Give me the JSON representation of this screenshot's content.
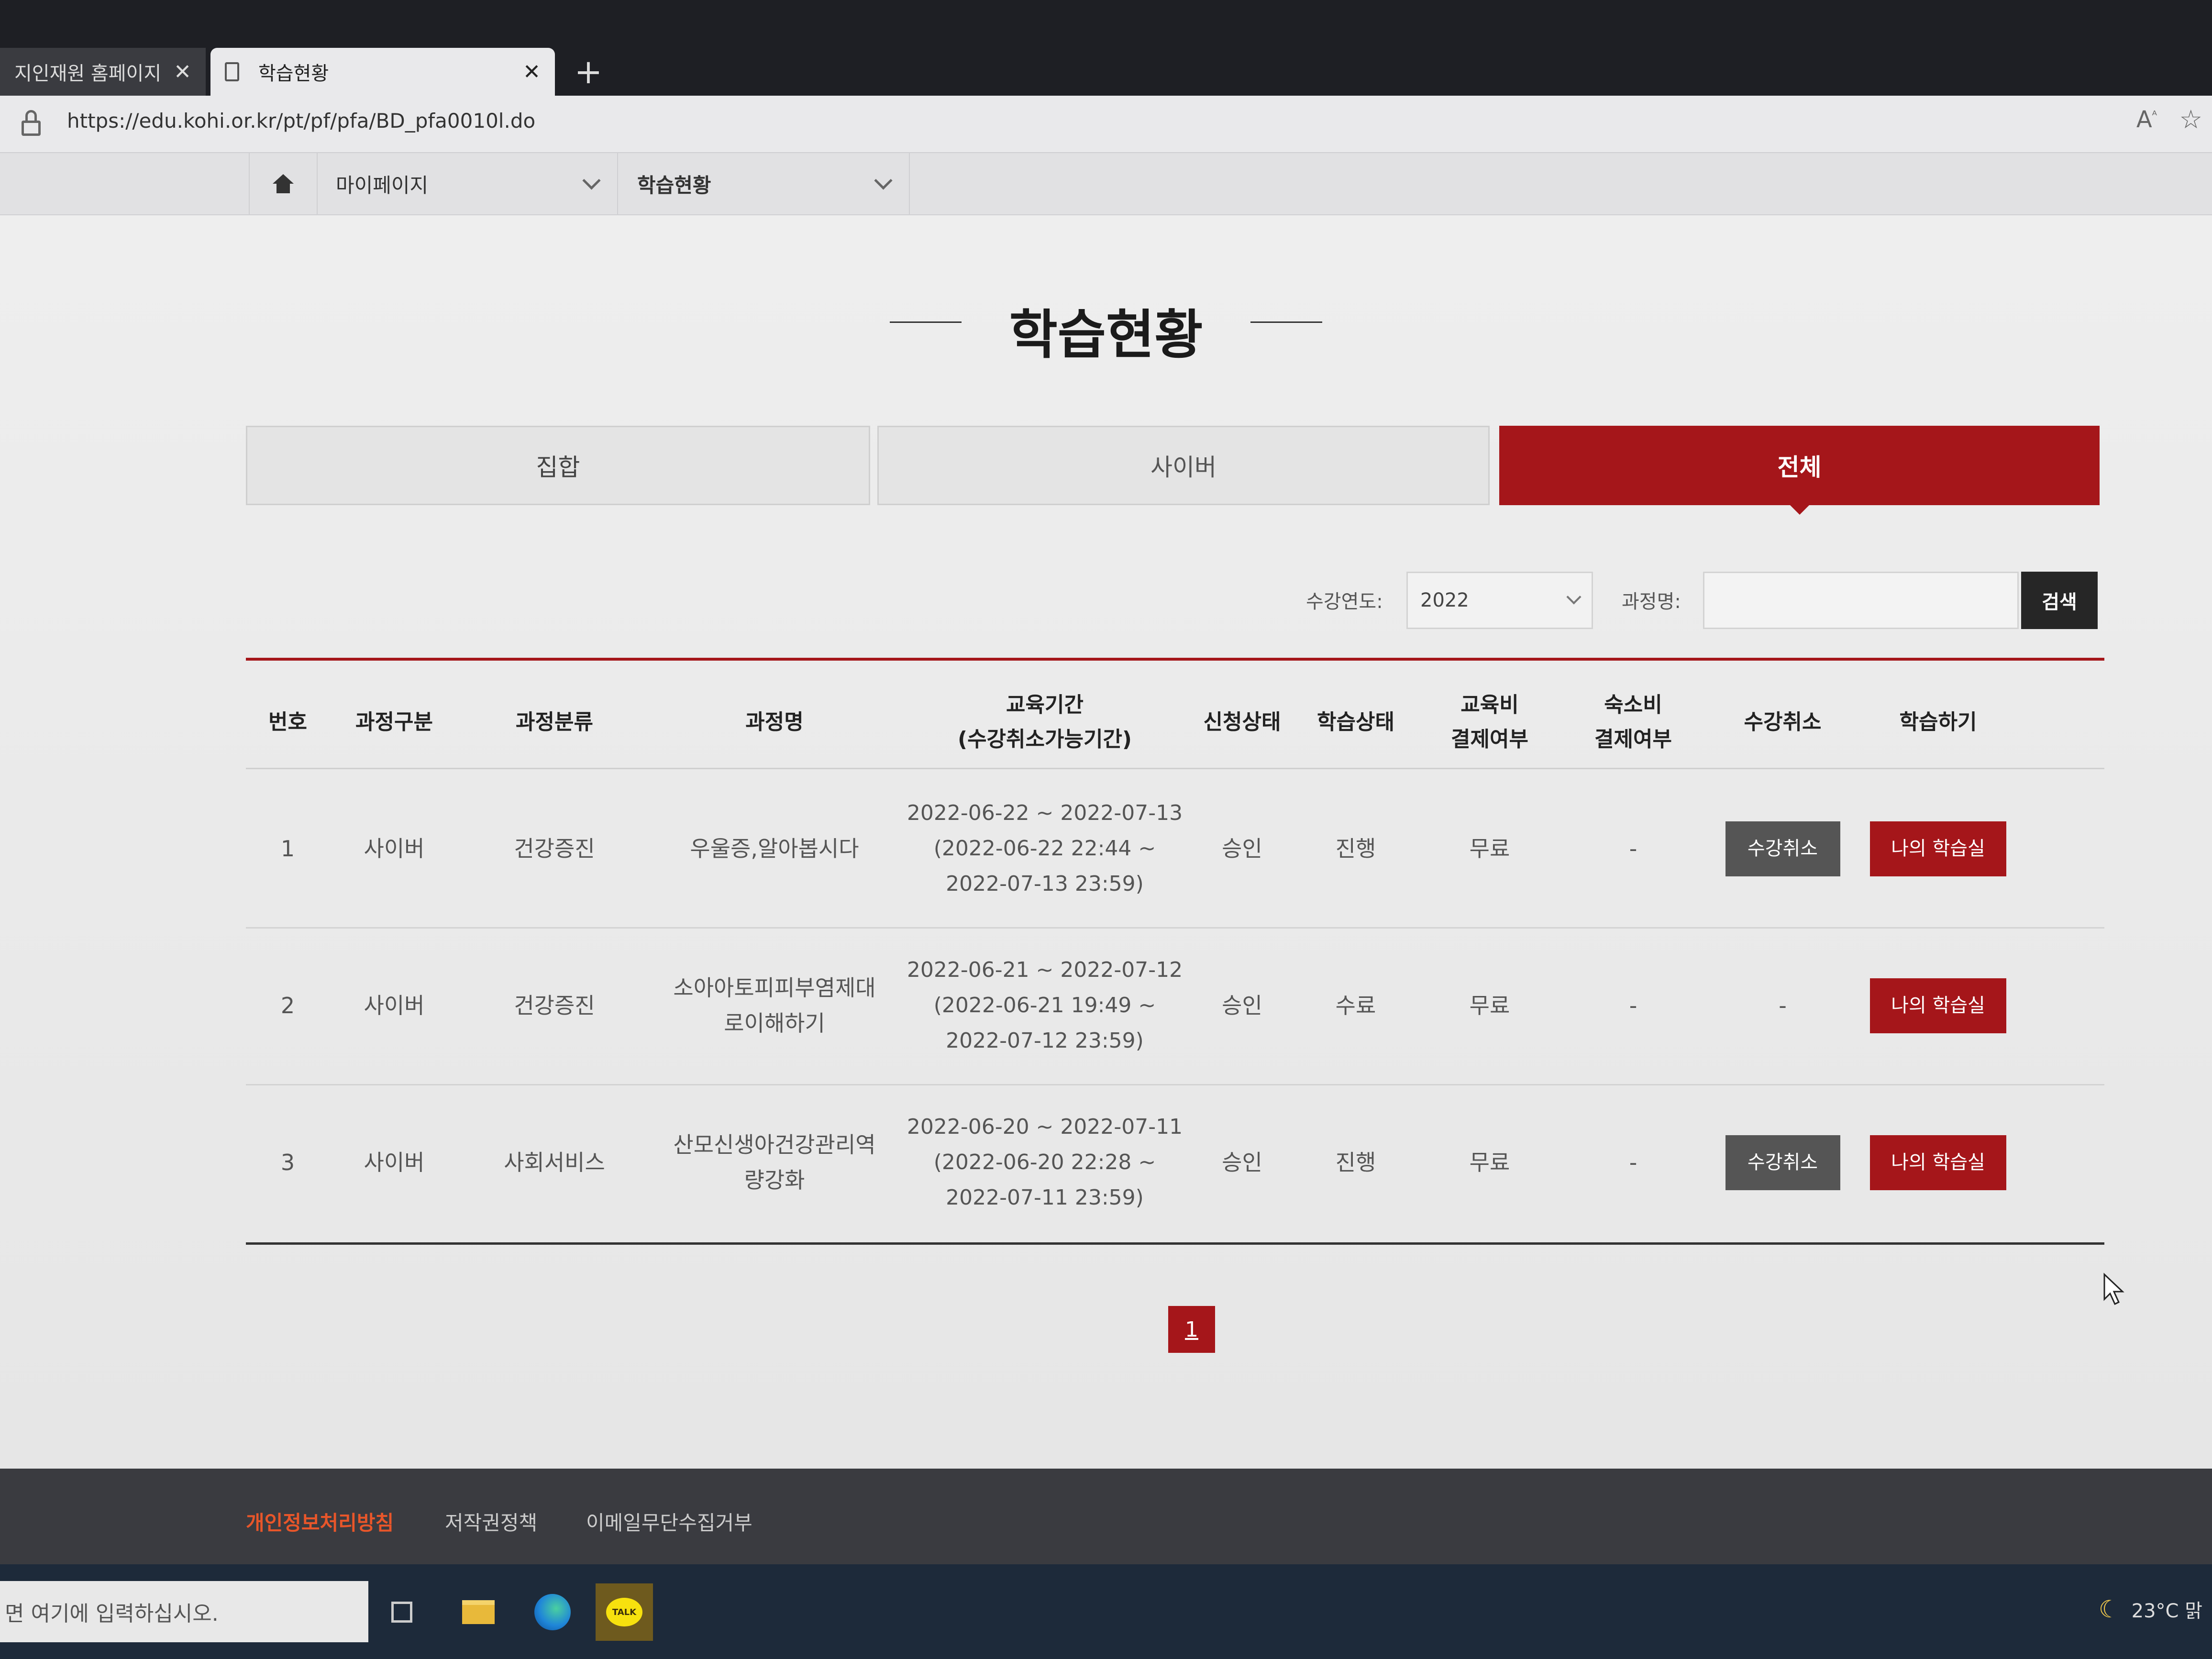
{
  "browser": {
    "tabs": [
      {
        "title": "지인재원 홈페이지 :",
        "active": false
      },
      {
        "title": "학습현황",
        "active": true
      }
    ],
    "url": "https://edu.kohi.or.kr/pt/pf/pfa/BD_pfa0010l.do",
    "new_tab": "+",
    "close": "✕"
  },
  "nav": {
    "home_icon": "home-icon",
    "items": [
      {
        "label": "마이페이지"
      },
      {
        "label": "학습현황"
      }
    ]
  },
  "page": {
    "title": "학습현황",
    "tabs": [
      {
        "label": "집합",
        "active": false
      },
      {
        "label": "사이버",
        "active": false
      },
      {
        "label": "전체",
        "active": true
      }
    ]
  },
  "search": {
    "year_label": "수강연도:",
    "year_value": "2022",
    "course_label": "과정명:",
    "course_value": "",
    "button": "검색"
  },
  "table": {
    "headers": {
      "no": "번호",
      "type": "과정구분",
      "category": "과정분류",
      "name": "과정명",
      "period_1": "교육기간",
      "period_2": "(수강취소가능기간)",
      "apply": "신청상태",
      "learn": "학습상태",
      "fee_1": "교육비",
      "fee_2": "결제여부",
      "lodging_1": "숙소비",
      "lodging_2": "결제여부",
      "cancel": "수강취소",
      "study": "학습하기"
    },
    "rows": [
      {
        "no": "1",
        "type": "사이버",
        "category": "건강증진",
        "name_1": "우울증,알아봅시다",
        "name_2": "",
        "period": "2022-06-22 ~ 2022-07-13",
        "cancel_1": "(2022-06-22 22:44 ~",
        "cancel_2": "2022-07-13 23:59)",
        "apply": "승인",
        "learn": "진행",
        "fee": "무료",
        "lodging": "-",
        "cancel_btn": "수강취소",
        "study_btn": "나의 학습실"
      },
      {
        "no": "2",
        "type": "사이버",
        "category": "건강증진",
        "name_1": "소아아토피피부염제대",
        "name_2": "로이해하기",
        "period": "2022-06-21 ~ 2022-07-12",
        "cancel_1": "(2022-06-21 19:49 ~",
        "cancel_2": "2022-07-12 23:59)",
        "apply": "승인",
        "learn": "수료",
        "fee": "무료",
        "lodging": "-",
        "cancel_text": "-",
        "study_btn": "나의 학습실"
      },
      {
        "no": "3",
        "type": "사이버",
        "category": "사회서비스",
        "name_1": "산모신생아건강관리역",
        "name_2": "량강화",
        "period": "2022-06-20 ~ 2022-07-11",
        "cancel_1": "(2022-06-20 22:28 ~",
        "cancel_2": "2022-07-11 23:59)",
        "apply": "승인",
        "learn": "진행",
        "fee": "무료",
        "lodging": "-",
        "cancel_btn": "수강취소",
        "study_btn": "나의 학습실"
      }
    ]
  },
  "pagination": {
    "current": "1"
  },
  "footer": {
    "links": [
      {
        "label": "개인정보처리방침"
      },
      {
        "label": "저작권정책"
      },
      {
        "label": "이메일무단수집거부"
      }
    ]
  },
  "taskbar": {
    "search_placeholder": "면 여기에 입력하십시오.",
    "kakao_label": "TALK",
    "weather": "23°C 맑"
  },
  "colors": {
    "accent": "#a5161a",
    "dark_button": "#555555",
    "search_button": "#262626",
    "footer_link_highlight": "#e8562a"
  }
}
